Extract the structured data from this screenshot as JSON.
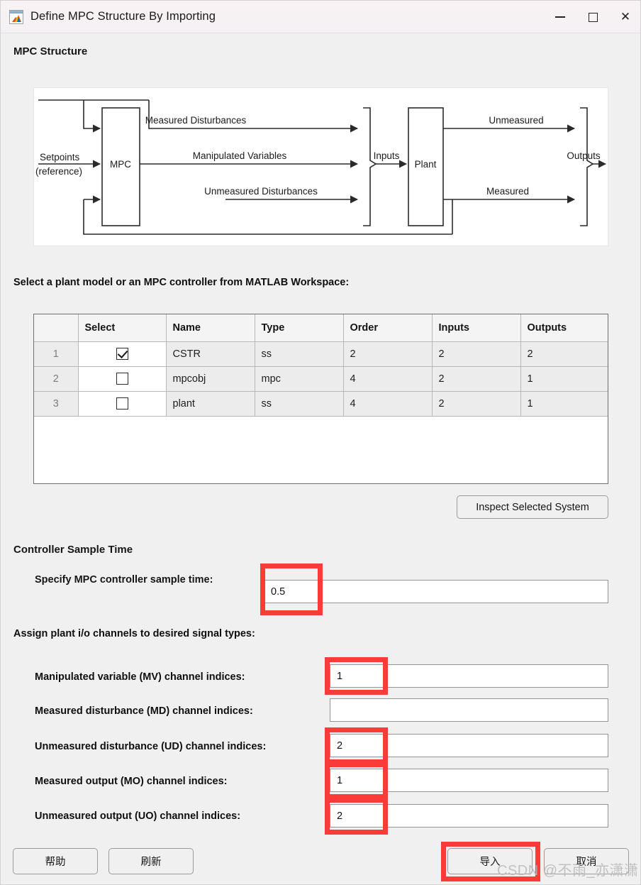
{
  "window": {
    "title": "Define MPC Structure By Importing",
    "icon": "matlab-icon",
    "controls": {
      "minimize": "–",
      "maximize": "❐",
      "close": "✕"
    }
  },
  "sections": {
    "mpc_structure_title": "MPC Structure",
    "select_model_label": "Select a plant model or an MPC controller from MATLAB Workspace:",
    "controller_sample_time_title": "Controller Sample Time",
    "assign_channels_label": "Assign plant i/o channels to desired signal types:"
  },
  "diagram": {
    "controller_block": "MPC",
    "plant_block": "Plant",
    "setpoints_line1": "Setpoints",
    "setpoints_line2": "(reference)",
    "measured_disturbances": "Measured Disturbances",
    "manipulated_variables": "Manipulated Variables",
    "unmeasured_disturbances": "Unmeasured Disturbances",
    "inputs": "Inputs",
    "outputs": "Outputs",
    "unmeasured": "Unmeasured",
    "measured": "Measured"
  },
  "table": {
    "columns": [
      "",
      "Select",
      "Name",
      "Type",
      "Order",
      "Inputs",
      "Outputs"
    ],
    "rows": [
      {
        "index": "1",
        "selected": true,
        "name": "CSTR",
        "type": "ss",
        "order": "2",
        "inputs": "2",
        "outputs": "2"
      },
      {
        "index": "2",
        "selected": false,
        "name": "mpcobj",
        "type": "mpc",
        "order": "4",
        "inputs": "2",
        "outputs": "1"
      },
      {
        "index": "3",
        "selected": false,
        "name": "plant",
        "type": "ss",
        "order": "4",
        "inputs": "2",
        "outputs": "1"
      }
    ]
  },
  "buttons": {
    "inspect": "Inspect Selected System",
    "help": "帮助",
    "refresh": "刷新",
    "import": "导入",
    "cancel": "取消"
  },
  "fields": {
    "sample_time": {
      "label": "Specify MPC controller sample time:",
      "value": "0.5",
      "placeholder": ""
    },
    "mv": {
      "label": "Manipulated variable (MV) channel indices:",
      "value": "1",
      "placeholder": ""
    },
    "md": {
      "label": "Measured disturbance (MD) channel indices:",
      "value": "",
      "placeholder": ""
    },
    "ud": {
      "label": "Unmeasured disturbance (UD) channel indices:",
      "value": "2",
      "placeholder": ""
    },
    "mo": {
      "label": "Measured output (MO) channel indices:",
      "value": "1",
      "placeholder": ""
    },
    "uo": {
      "label": "Unmeasured output (UO) channel indices:",
      "value": "2",
      "placeholder": ""
    }
  },
  "annotations": {
    "highlight_color": "#fa3b37",
    "count": 6
  },
  "watermark": {
    "text": "CSDN @不雨_亦潇潇"
  }
}
